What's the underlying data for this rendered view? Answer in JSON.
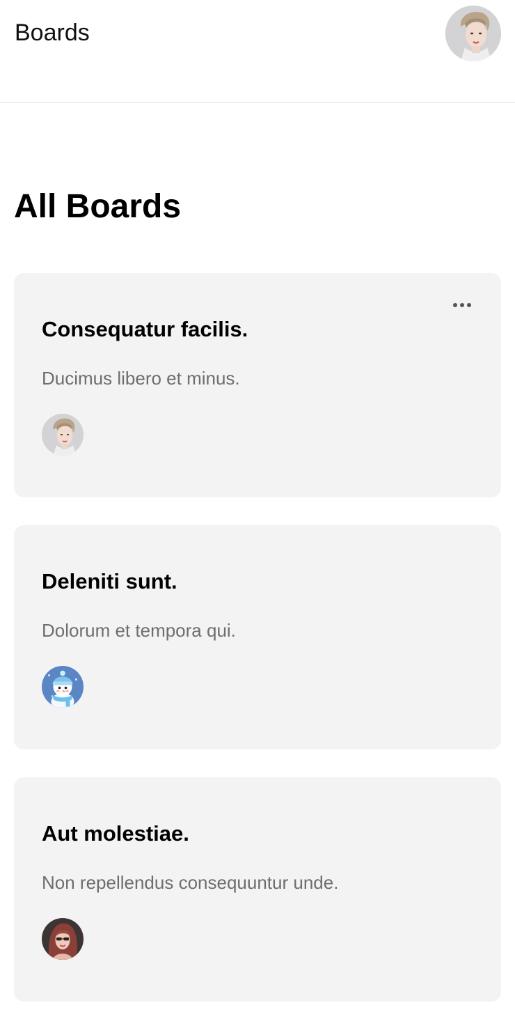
{
  "header": {
    "title": "Boards",
    "profile_avatar": "user-avatar-woman-blonde"
  },
  "main": {
    "heading": "All Boards",
    "more_icon": "more-horizontal-icon",
    "boards": [
      {
        "name": "Consequatur facilis.",
        "description": "Ducimus libero et minus.",
        "member_avatar": "avatar-woman-blonde",
        "has_menu": true
      },
      {
        "name": "Deleniti sunt.",
        "description": "Dolorum et tempora qui.",
        "member_avatar": "avatar-snowman",
        "has_menu": false
      },
      {
        "name": "Aut molestiae.",
        "description": "Non repellendus consequuntur unde.",
        "member_avatar": "avatar-woman-redhead",
        "has_menu": false
      }
    ]
  },
  "colors": {
    "card_background": "#f3f3f3",
    "description_text": "#6e6e6e",
    "divider": "#efefef"
  }
}
